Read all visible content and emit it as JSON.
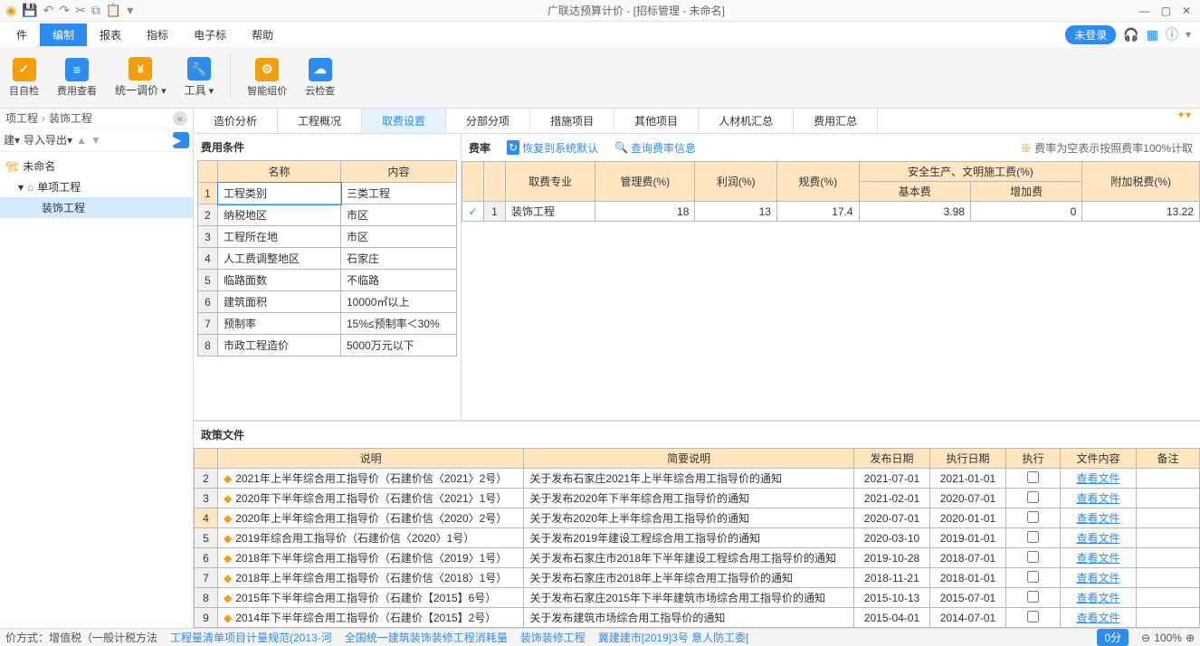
{
  "app_title": "广联达预算计价 - [招标管理 - 未命名]",
  "menu": {
    "items": [
      "件",
      "编制",
      "报表",
      "指标",
      "电子标",
      "帮助"
    ],
    "active": 1,
    "login": "未登录"
  },
  "ribbon": [
    {
      "label": "目自检",
      "color": "#f59e0b"
    },
    {
      "label": "费用查看",
      "color": "#2d8cf0"
    },
    {
      "label": "统一调价",
      "color": "#f59e0b"
    },
    {
      "label": "工具",
      "color": "#2d8cf0"
    },
    {
      "label": "智能组价",
      "color": "#f59e0b"
    },
    {
      "label": "云检查",
      "color": "#2d8cf0"
    }
  ],
  "breadcrumb": {
    "a": "项工程",
    "b": "装饰工程"
  },
  "proj_toolbar": {
    "new": "建",
    "io": "导入导出"
  },
  "tree": {
    "root": "未命名",
    "child1": "单项工程",
    "child2": "装饰工程"
  },
  "tabs": {
    "items": [
      "造价分析",
      "工程概况",
      "取费设置",
      "分部分项",
      "措施项目",
      "其他项目",
      "人材机汇总",
      "费用汇总"
    ],
    "active": 2
  },
  "cond": {
    "title": "费用条件",
    "head": {
      "name": "名称",
      "content": "内容"
    },
    "rows": [
      {
        "n": "1",
        "name": "工程类别",
        "val": "三类工程"
      },
      {
        "n": "2",
        "name": "纳税地区",
        "val": "市区"
      },
      {
        "n": "3",
        "name": "工程所在地",
        "val": "市区"
      },
      {
        "n": "4",
        "name": "人工费调整地区",
        "val": "石家庄"
      },
      {
        "n": "5",
        "name": "临路面数",
        "val": "不临路"
      },
      {
        "n": "6",
        "name": "建筑面积",
        "val": "10000㎡以上"
      },
      {
        "n": "7",
        "name": "预制率",
        "val": "15%≤预制率＜30%"
      },
      {
        "n": "8",
        "name": "市政工程造价",
        "val": "5000万元以下"
      }
    ]
  },
  "rate": {
    "title": "费率",
    "reset": "恢复到系统默认",
    "query": "查询费率信息",
    "note": "费率为空表示按照费率100%计取",
    "head": {
      "spec": "取费专业",
      "mgmt": "管理费(%)",
      "profit": "利润(%)",
      "reg": "规费(%)",
      "safe": "安全生产、文明施工费(%)",
      "base": "基本费",
      "add": "增加费",
      "tax": "附加税费(%)"
    },
    "row": {
      "n": "1",
      "name": "装饰工程",
      "mgmt": "18",
      "profit": "13",
      "reg": "17.4",
      "base": "3.98",
      "add": "0",
      "tax": "13.22"
    }
  },
  "policy": {
    "title": "政策文件",
    "head": {
      "desc": "说明",
      "brief": "简要说明",
      "pub": "发布日期",
      "exe_date": "执行日期",
      "exe": "执行",
      "file": "文件内容",
      "note": "备注"
    },
    "view": "查看文件",
    "rows": [
      {
        "n": "2",
        "desc": "2021年上半年综合用工指导价（石建价信〈2021〉2号）",
        "brief": "关于发布石家庄2021年上半年综合用工指导价的通知",
        "pub": "2021-07-01",
        "exe": "2021-01-01"
      },
      {
        "n": "3",
        "desc": "2020年下半年综合用工指导价（石建价信〈2021〉1号）",
        "brief": "关于发布2020年下半年综合用工指导价的通知",
        "pub": "2021-02-01",
        "exe": "2020-07-01"
      },
      {
        "n": "4",
        "desc": "2020年上半年综合用工指导价（石建价信〈2020〉2号）",
        "brief": "关于发布2020年上半年综合用工指导价的通知",
        "pub": "2020-07-01",
        "exe": "2020-01-01"
      },
      {
        "n": "5",
        "desc": "2019年综合用工指导价（石建价信〈2020〉1号）",
        "brief": "关于发布2019年建设工程综合用工指导价的通知",
        "pub": "2020-03-10",
        "exe": "2019-01-01"
      },
      {
        "n": "6",
        "desc": "2018年下半年综合用工指导价（石建价信〈2019〉1号）",
        "brief": "关于发布石家庄市2018年下半年建设工程综合用工指导价的通知",
        "pub": "2019-10-28",
        "exe": "2018-07-01"
      },
      {
        "n": "7",
        "desc": "2018年上半年综合用工指导价（石建价信〈2018〉1号）",
        "brief": "关于发布石家庄市2018年上半年综合用工指导价的通知",
        "pub": "2018-11-21",
        "exe": "2018-01-01"
      },
      {
        "n": "8",
        "desc": "2015年下半年综合用工指导价（石建价【2015】6号）",
        "brief": "关于发布石家庄2015年下半年建筑市场综合用工指导价的通知",
        "pub": "2015-10-13",
        "exe": "2015-07-01"
      },
      {
        "n": "9",
        "desc": "2014年下半年综合用工指导价（石建价【2015】2号）",
        "brief": "关于发布建筑市场综合用工指导价的通知",
        "pub": "2015-04-01",
        "exe": "2014-07-01"
      }
    ]
  },
  "status": {
    "a": "价方式：增值税（一般计税方法",
    "b": "工程量清单项目计量规范(2013-河",
    "c": "全国统一建筑装饰装修工程消耗量",
    "d": "装饰装修工程",
    "e": "冀建建市[2019]3号  意人防工委[",
    "time": "0分",
    "zoom": "100%"
  }
}
